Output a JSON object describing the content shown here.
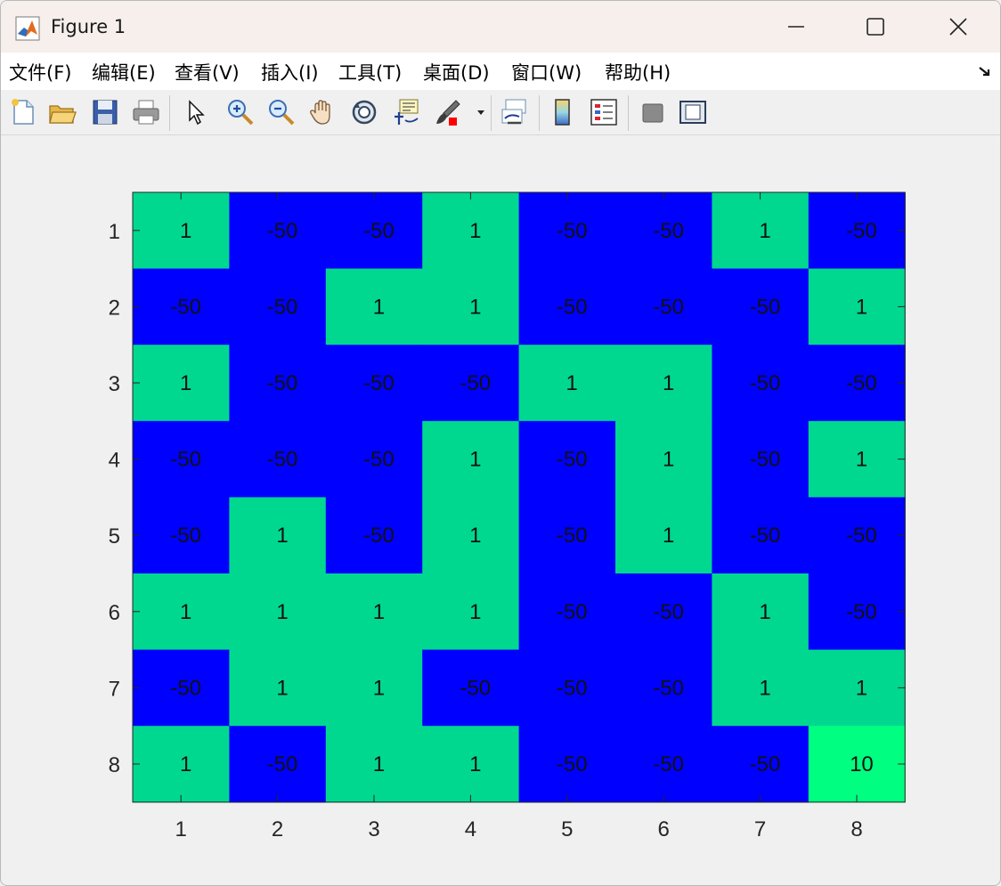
{
  "window": {
    "title": "Figure 1"
  },
  "menu": {
    "items": [
      "文件(F)",
      "编辑(E)",
      "查看(V)",
      "插入(I)",
      "工具(T)",
      "桌面(D)",
      "窗口(W)",
      "帮助(H)"
    ]
  },
  "toolbar": {
    "icons": [
      "new-figure-icon",
      "open-file-icon",
      "save-icon",
      "print-icon",
      "pointer-icon",
      "zoom-in-icon",
      "zoom-out-icon",
      "pan-icon",
      "rotate-3d-icon",
      "data-cursor-icon",
      "brush-icon",
      "link-plot-icon",
      "colorbar-icon",
      "legend-icon",
      "hide-plot-tools-icon",
      "show-plot-tools-icon"
    ]
  },
  "chart_data": {
    "type": "heatmap",
    "title": "",
    "xlabel": "",
    "ylabel": "",
    "x_ticks": [
      "1",
      "2",
      "3",
      "4",
      "5",
      "6",
      "7",
      "8"
    ],
    "y_ticks": [
      "1",
      "2",
      "3",
      "4",
      "5",
      "6",
      "7",
      "8"
    ],
    "values": [
      [
        1,
        -50,
        -50,
        1,
        -50,
        -50,
        1,
        -50
      ],
      [
        -50,
        -50,
        1,
        1,
        -50,
        -50,
        -50,
        1
      ],
      [
        1,
        -50,
        -50,
        -50,
        1,
        1,
        -50,
        -50
      ],
      [
        -50,
        -50,
        -50,
        1,
        -50,
        1,
        -50,
        1
      ],
      [
        -50,
        1,
        -50,
        1,
        -50,
        1,
        -50,
        -50
      ],
      [
        1,
        1,
        1,
        1,
        -50,
        -50,
        1,
        -50
      ],
      [
        -50,
        1,
        1,
        -50,
        -50,
        -50,
        1,
        1
      ],
      [
        1,
        -50,
        1,
        1,
        -50,
        -50,
        -50,
        10
      ]
    ],
    "colors": {
      "-50": "#0000ff",
      "1": "#00d890",
      "10": "#00ff80"
    },
    "grid": false
  }
}
